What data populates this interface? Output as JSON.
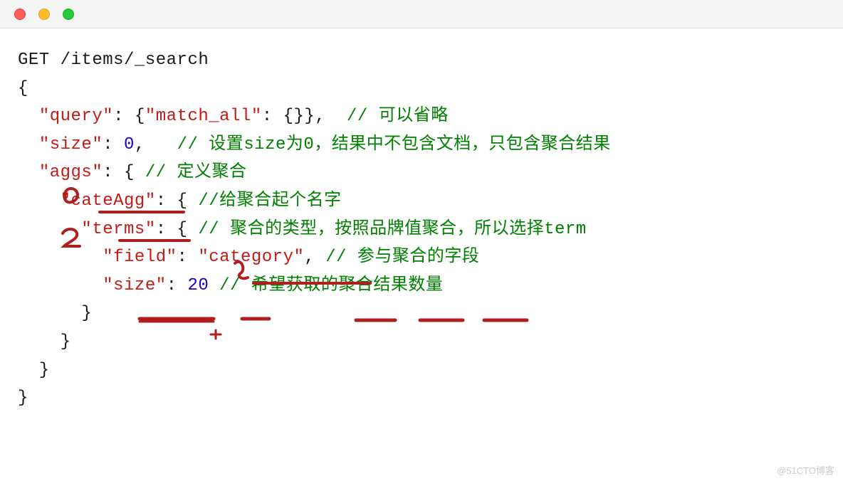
{
  "window": {
    "close": "close",
    "min": "minimize",
    "max": "maximize"
  },
  "code": {
    "line1": "GET /items/_search",
    "line2": "{",
    "line3": {
      "indent": "  ",
      "key": "\"query\"",
      "colon": ": {",
      "inner_key": "\"match_all\"",
      "inner_val": ": {}},  ",
      "comment": "// 可以省略"
    },
    "line4": {
      "indent": "  ",
      "key": "\"size\"",
      "colon": ": ",
      "num": "0",
      "after": ",   ",
      "comment": "// 设置size为0，结果中不包含文档，只包含聚合结果"
    },
    "line5": {
      "indent": "  ",
      "key": "\"aggs\"",
      "colon": ": { ",
      "comment": "// 定义聚合"
    },
    "line6": {
      "indent": "    ",
      "key": "\"cateAgg\"",
      "colon": ": { ",
      "comment": "//给聚合起个名字"
    },
    "line7": {
      "indent": "      ",
      "key": "\"terms\"",
      "colon": ": { ",
      "comment": "// 聚合的类型，按照品牌值聚合，所以选择term"
    },
    "line8": {
      "indent": "        ",
      "key": "\"field\"",
      "colon": ": ",
      "val": "\"category\"",
      "after": ", ",
      "comment": "// 参与聚合的字段"
    },
    "line9": {
      "indent": "        ",
      "key": "\"size\"",
      "colon": ": ",
      "num": "20",
      "after": " ",
      "comment": "// 希望获取的聚合结果数量"
    },
    "line10": "      }",
    "line11": "    }",
    "line12": "  }",
    "line13": "}"
  },
  "watermark": "@51CTO博客",
  "annotation_color": "#b01e1e"
}
